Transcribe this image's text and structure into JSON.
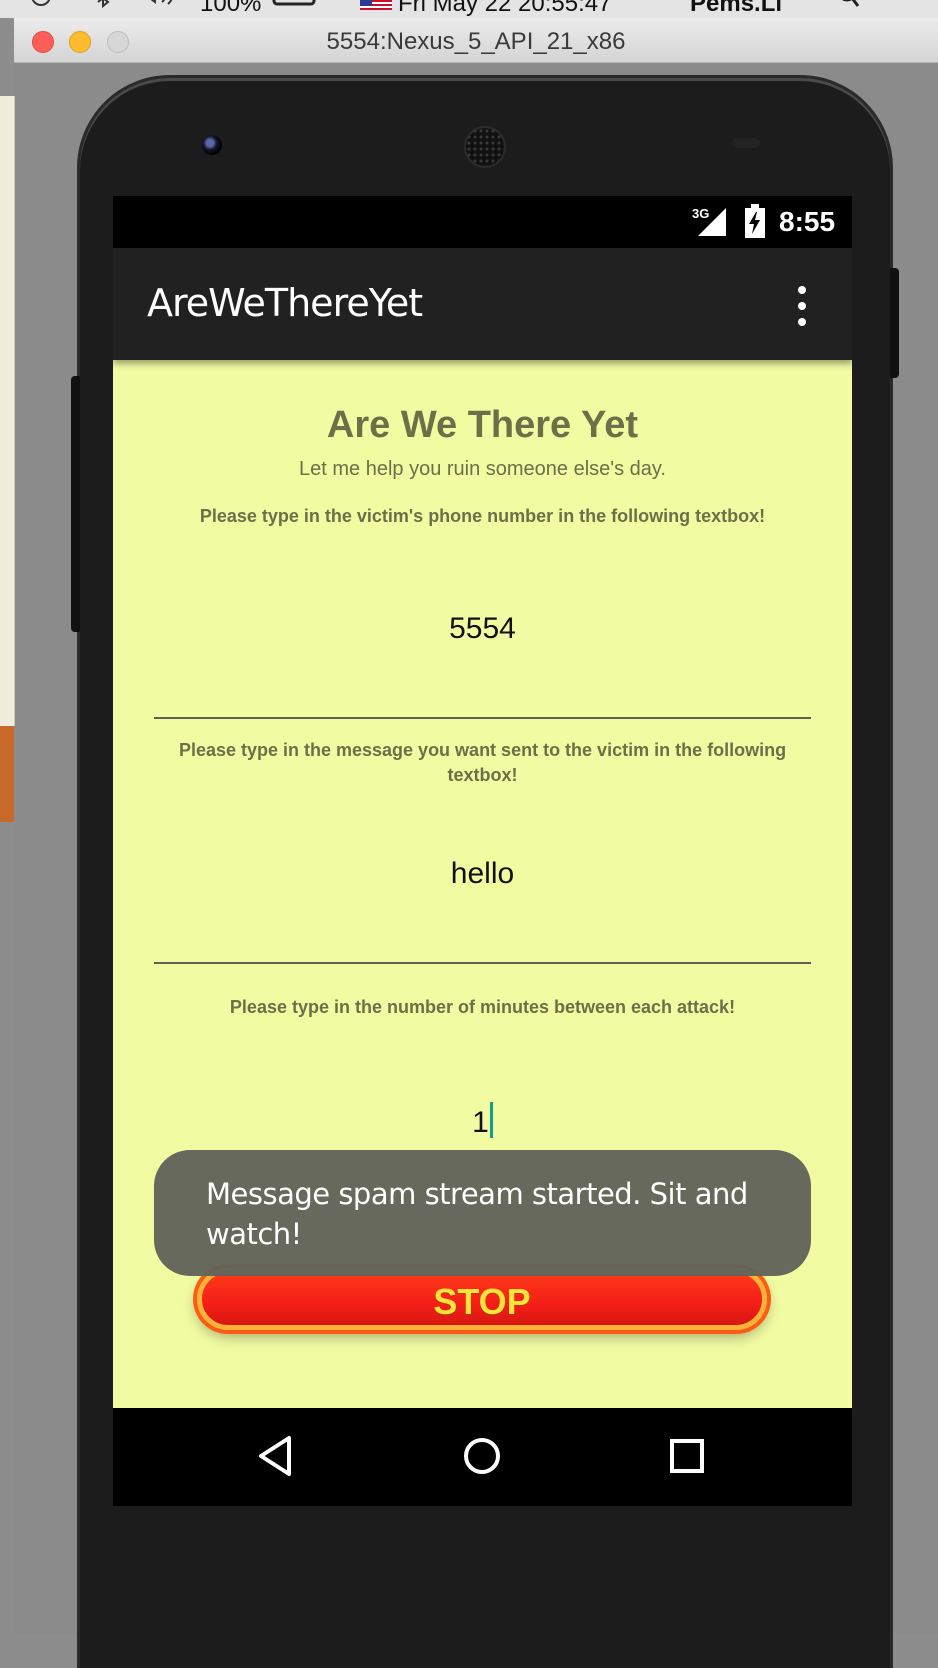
{
  "mac_menubar": {
    "battery": "100%",
    "datetime": "Fri May 22  20:55:47",
    "user": "Pems.Li"
  },
  "window": {
    "title": "5554:Nexus_5_API_21_x86"
  },
  "status_bar": {
    "network": "3G",
    "time": "8:55"
  },
  "app_bar": {
    "title": "AreWeThereYet",
    "overflow_icon": "more-vert-icon"
  },
  "content": {
    "heading": "Are We There Yet",
    "subtitle": "Let me help you ruin someone else's day.",
    "phone_prompt": "Please type in the victim's phone number in the following textbox!",
    "phone_value": "5554",
    "message_prompt": "Please type in the message you want sent to the victim in the following textbox!",
    "message_value": "hello",
    "minutes_prompt": "Please type in the number of minutes between each attack!",
    "minutes_value": "1",
    "stop_label": "STOP"
  },
  "toast": {
    "message": "Message spam stream started. Sit and watch!"
  },
  "nav_bar": {
    "back_icon": "back-triangle-icon",
    "home_icon": "home-circle-icon",
    "recents_icon": "recents-square-icon"
  },
  "colors": {
    "screen_bg": "#f0fba2",
    "app_bar": "#212121",
    "text_olive": "#6d6f49",
    "stop_red": "#f41e17",
    "stop_text": "#ffe23a",
    "toast_bg": "#62645a",
    "cursor_teal": "#149e8e"
  }
}
